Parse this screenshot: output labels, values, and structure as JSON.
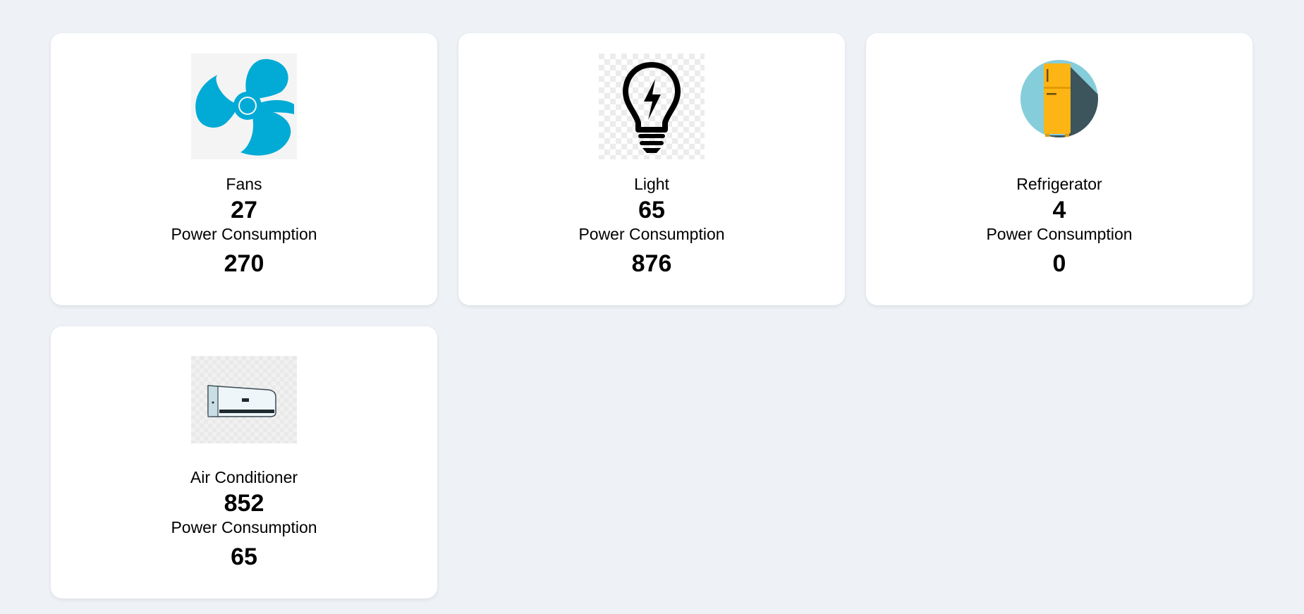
{
  "colors": {
    "background": "#eef1f6",
    "card": "#ffffff",
    "fan": "#02abd6",
    "refrigerator_circle": "#86cddb",
    "refrigerator_body": "#fdb515"
  },
  "cards": [
    {
      "icon": "fan-icon",
      "name": "Fans",
      "count": "27",
      "power_label": "Power Consumption",
      "power_value": "270"
    },
    {
      "icon": "light-bulb-icon",
      "name": "Light",
      "count": "65",
      "power_label": "Power Consumption",
      "power_value": "876"
    },
    {
      "icon": "refrigerator-icon",
      "name": "Refrigerator",
      "count": "4",
      "power_label": "Power Consumption",
      "power_value": "0"
    },
    {
      "icon": "air-conditioner-icon",
      "name": "Air Conditioner",
      "count": "852",
      "power_label": "Power Consumption",
      "power_value": "65"
    }
  ]
}
